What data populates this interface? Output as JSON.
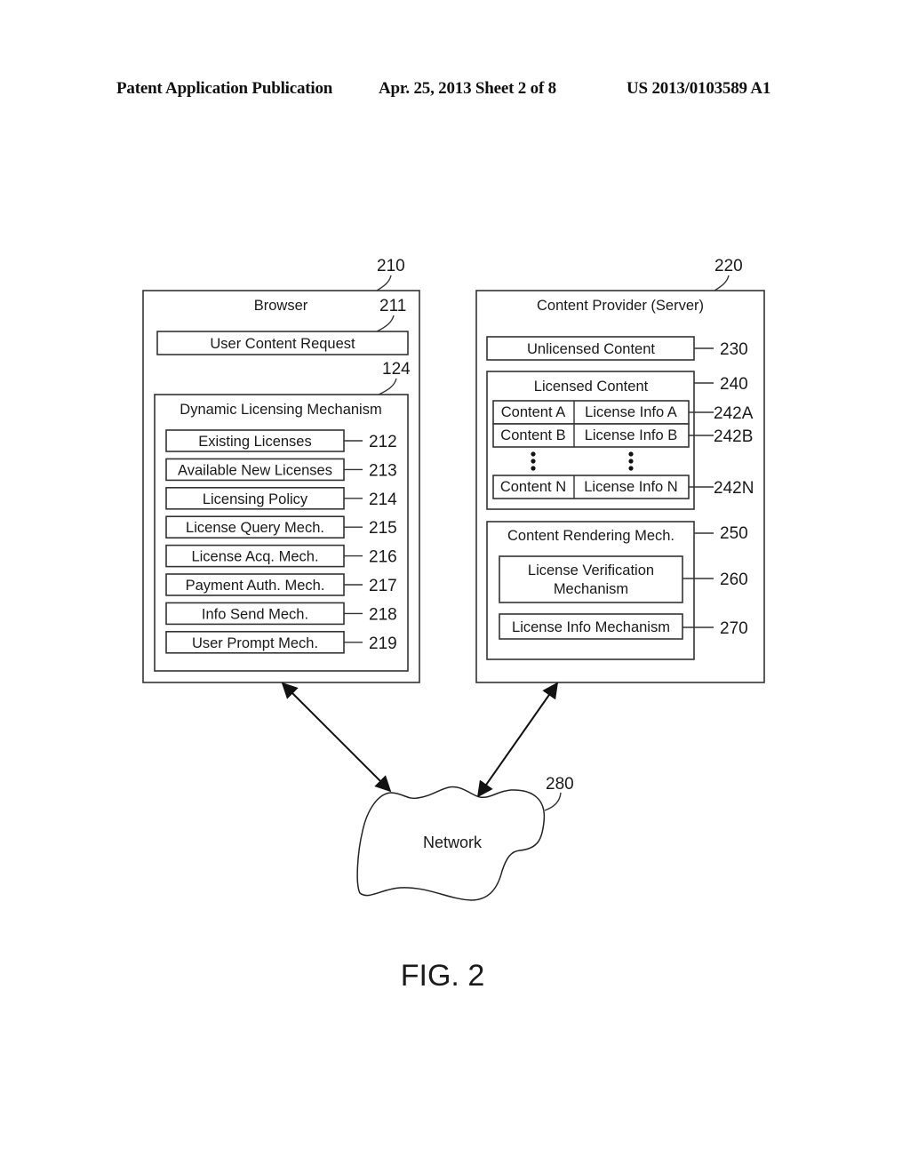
{
  "header": {
    "left": "Patent Application Publication",
    "center": "Apr. 25, 2013  Sheet 2 of 8",
    "right": "US 2013/0103589 A1"
  },
  "browser": {
    "ref": "210",
    "title": "Browser",
    "request": {
      "ref": "211",
      "label": "User Content Request"
    },
    "dlm": {
      "ref": "124",
      "title": "Dynamic Licensing Mechanism",
      "items": [
        {
          "label": "Existing Licenses",
          "ref": "212"
        },
        {
          "label": "Available New Licenses",
          "ref": "213"
        },
        {
          "label": "Licensing Policy",
          "ref": "214"
        },
        {
          "label": "License Query Mech.",
          "ref": "215"
        },
        {
          "label": "License Acq. Mech.",
          "ref": "216"
        },
        {
          "label": "Payment Auth. Mech.",
          "ref": "217"
        },
        {
          "label": "Info Send Mech.",
          "ref": "218"
        },
        {
          "label": "User Prompt Mech.",
          "ref": "219"
        }
      ]
    }
  },
  "server": {
    "ref": "220",
    "title": "Content Provider (Server)",
    "unlicensed": {
      "label": "Unlicensed Content",
      "ref": "230"
    },
    "licensed": {
      "label": "Licensed Content",
      "ref": "240",
      "rows": [
        {
          "content": "Content A",
          "info": "License Info A",
          "ref": "242A"
        },
        {
          "content": "Content B",
          "info": "License Info B",
          "ref": "242B"
        },
        {
          "content": "Content N",
          "info": "License Info N",
          "ref": "242N"
        }
      ]
    },
    "rendering": {
      "label": "Content Rendering Mech.",
      "ref": "250",
      "verification": {
        "line1": "License Verification",
        "line2": "Mechanism",
        "ref": "260"
      },
      "info_mech": {
        "label": "License Info Mechanism",
        "ref": "270"
      }
    }
  },
  "network": {
    "label": "Network",
    "ref": "280"
  },
  "figure_label": "FIG. 2"
}
